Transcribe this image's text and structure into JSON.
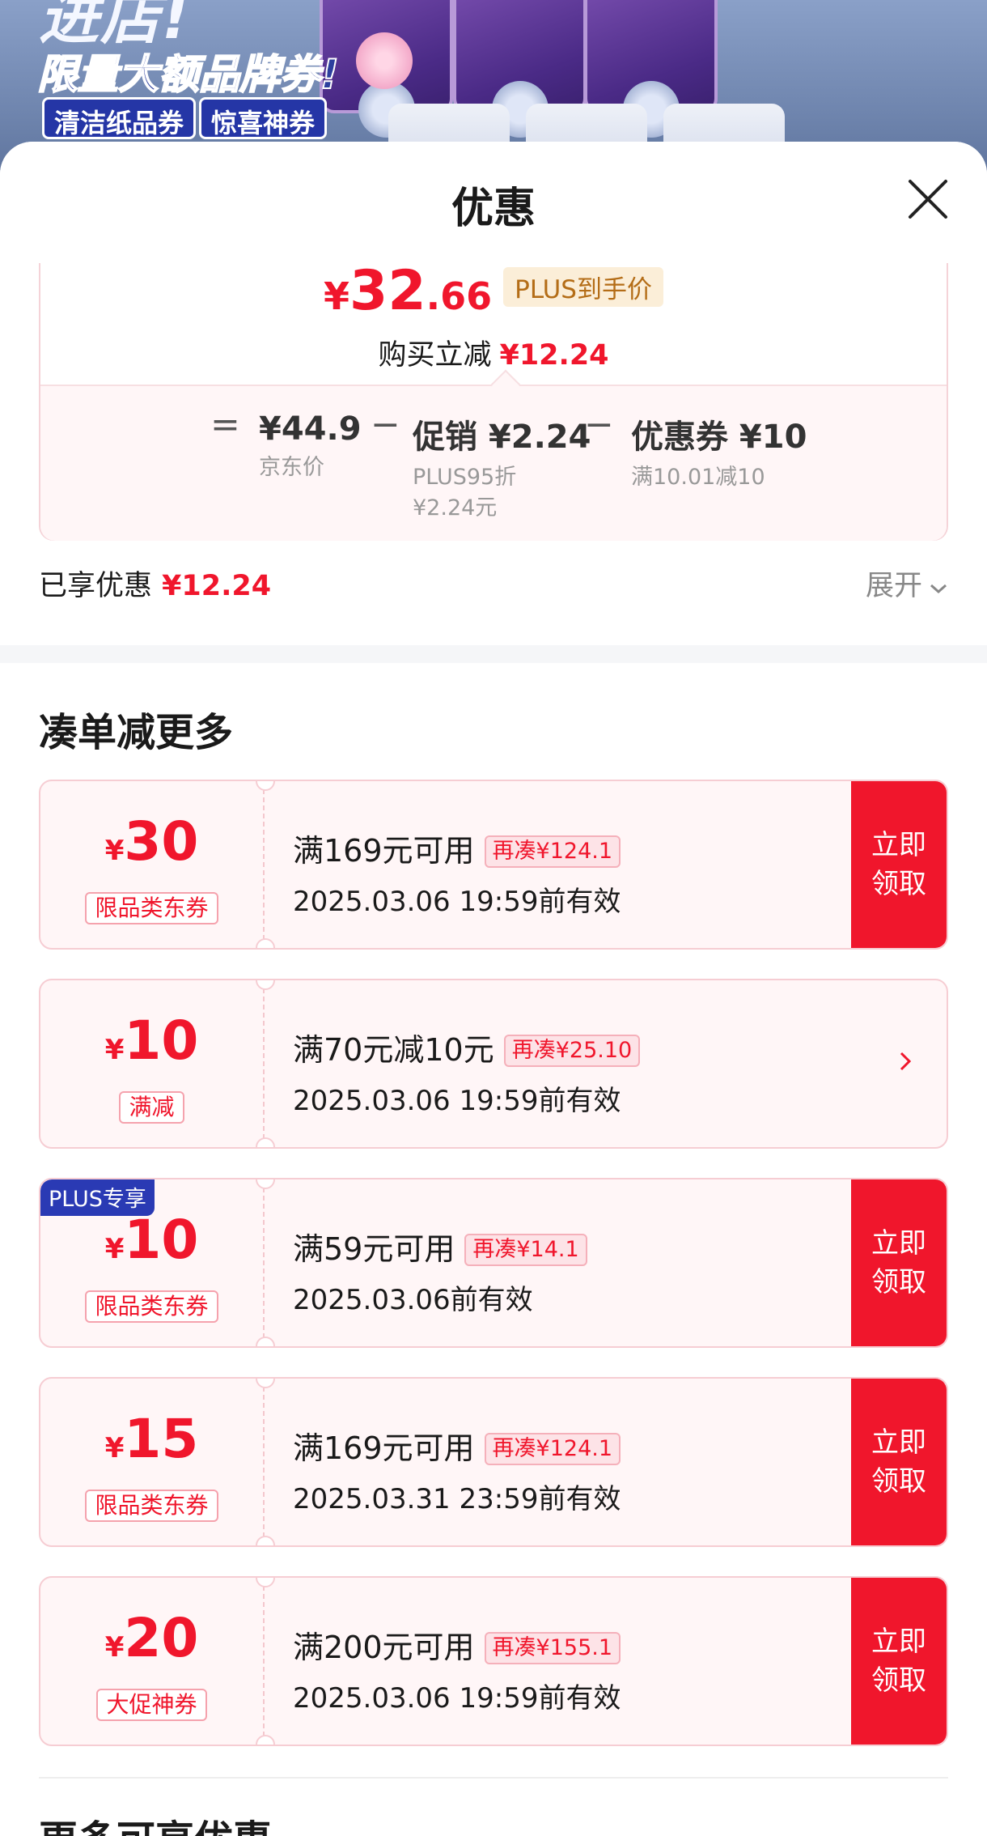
{
  "banner": {
    "headline": "进店!",
    "subline": "限量大额品牌券!",
    "tags": [
      "清洁纸品券",
      "惊喜神券"
    ]
  },
  "sheet": {
    "title": "优惠",
    "close_icon": "close-icon"
  },
  "price": {
    "currency": "¥",
    "integer": "32",
    "decimal": ".66",
    "tag": "PLUS到手价",
    "reduce_label": "购买立减",
    "reduce_amount": "¥12.24",
    "breakdown": {
      "eq": "=",
      "minus": "−",
      "base_main": "¥44.9",
      "base_sub": "京东价",
      "promo_main": "促销 ¥2.24",
      "promo_sub": "PLUS95折 ¥2.24元",
      "coupon_main": "优惠券 ¥10",
      "coupon_sub": "满10.01减10"
    }
  },
  "enjoyed": {
    "label": "已享优惠",
    "amount": "¥12.24",
    "expand_label": "展开"
  },
  "section_title": "凑单减更多",
  "coupons": [
    {
      "currency": "¥",
      "amount": "30",
      "kind": "限品类东券",
      "condition": "满169元可用",
      "need": "再凑¥124.1",
      "validity": "2025.03.06 19:59前有效",
      "action": "立即\n领取"
    },
    {
      "currency": "¥",
      "amount": "10",
      "kind": "满减",
      "condition": "满70元减10元",
      "need": "再凑¥25.10",
      "validity": "2025.03.06 19:59前有效",
      "action": ""
    },
    {
      "badge": "PLUS专享",
      "currency": "¥",
      "amount": "10",
      "kind": "限品类东券",
      "condition": "满59元可用",
      "need": "再凑¥14.1",
      "validity": "2025.03.06前有效",
      "action": "立即\n领取"
    },
    {
      "currency": "¥",
      "amount": "15",
      "kind": "限品类东券",
      "condition": "满169元可用",
      "need": "再凑¥124.1",
      "validity": "2025.03.31 23:59前有效",
      "action": "立即\n领取"
    },
    {
      "currency": "¥",
      "amount": "20",
      "kind": "大促神券",
      "condition": "满200元可用",
      "need": "再凑¥155.1",
      "validity": "2025.03.06 19:59前有效",
      "action": "立即\n领取"
    }
  ],
  "more_title": "更多可享优惠",
  "colors": {
    "accent_red": "#f0162c",
    "plus_blue": "#2a3ab4",
    "plus_tag_bg": "#fbeed8"
  }
}
